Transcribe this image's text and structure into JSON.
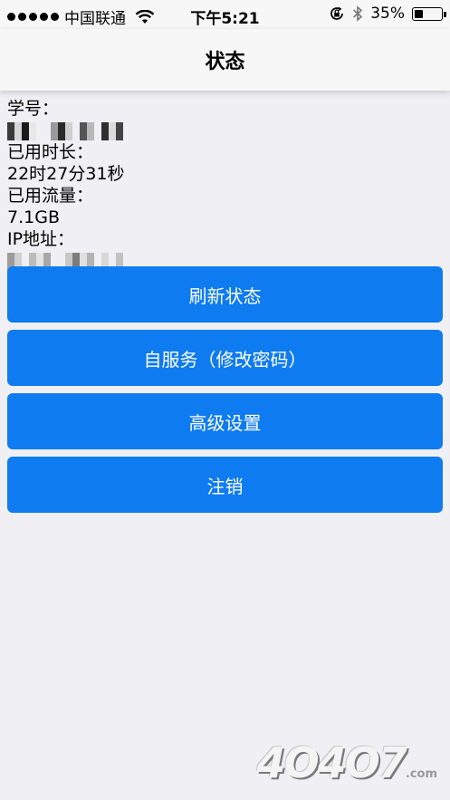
{
  "status_bar": {
    "carrier": "中国联通",
    "time": "下午5:21",
    "battery_percent": "35%",
    "battery_level": 0.35
  },
  "nav": {
    "title": "状态"
  },
  "info": {
    "student_id_label": "学号：",
    "time_used_label": "已用时长：",
    "time_used_value": "22时27分31秒",
    "data_used_label": "已用流量：",
    "data_used_value": "7.1GB",
    "ip_label": "IP地址："
  },
  "buttons": {
    "refresh": "刷新状态",
    "self_service": "自服务（修改密码）",
    "advanced": "高级设置",
    "logout": "注销"
  },
  "watermark": {
    "text": "4O4O7",
    "suffix": ".com"
  }
}
